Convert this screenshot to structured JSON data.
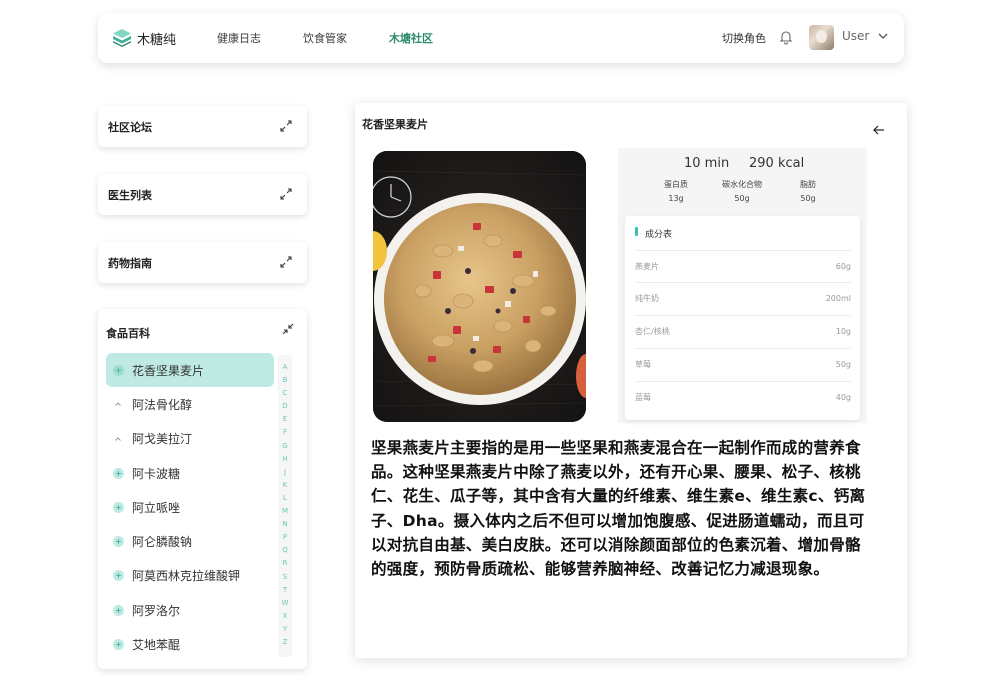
{
  "brand": {
    "name": "木糖纯",
    "icon": "cube-logo-icon"
  },
  "nav": {
    "items": [
      {
        "label": "健康日志",
        "active": false
      },
      {
        "label": "饮食管家",
        "active": false
      },
      {
        "label": "木塘社区",
        "active": true
      }
    ],
    "role_switch": "切换角色",
    "bell_icon": "bell-icon",
    "user_name": "User"
  },
  "sidebar": {
    "cards": [
      {
        "title": "社区论坛"
      },
      {
        "title": "医生列表"
      },
      {
        "title": "药物指南"
      }
    ],
    "food": {
      "title": "食品百科",
      "items": [
        {
          "name": "花香坚果麦片",
          "marker": "plus",
          "active": true
        },
        {
          "name": "阿法骨化醇",
          "marker": "caret",
          "active": false
        },
        {
          "name": "阿戈美拉汀",
          "marker": "caret",
          "active": false
        },
        {
          "name": "阿卡波糖",
          "marker": "plus",
          "active": false
        },
        {
          "name": "阿立哌唑",
          "marker": "plus",
          "active": false
        },
        {
          "name": "阿仑膦酸钠",
          "marker": "plus",
          "active": false
        },
        {
          "name": "阿莫西林克拉维酸钾",
          "marker": "plus",
          "active": false
        },
        {
          "name": "阿罗洛尔",
          "marker": "plus",
          "active": false
        },
        {
          "name": "艾地苯醌",
          "marker": "plus",
          "active": false
        }
      ],
      "alphabet": [
        "A",
        "B",
        "C",
        "D",
        "E",
        "F",
        "G",
        "H",
        "J",
        "K",
        "L",
        "M",
        "N",
        "P",
        "Q",
        "R",
        "S",
        "T",
        "W",
        "X",
        "Y",
        "Z"
      ]
    }
  },
  "detail": {
    "title": "花香坚果麦片",
    "time": "10 min",
    "kcal": "290 kcal",
    "nutrients": [
      {
        "label": "蛋白质",
        "value": "13g"
      },
      {
        "label": "碳水化合物",
        "value": "50g"
      },
      {
        "label": "脂肪",
        "value": "50g"
      }
    ],
    "ingredients_title": "成分表",
    "ingredients": [
      {
        "name": "燕麦片",
        "amount": "60g"
      },
      {
        "name": "纯牛奶",
        "amount": "200ml"
      },
      {
        "name": "杏仁/核桃",
        "amount": "10g"
      },
      {
        "name": "草莓",
        "amount": "50g"
      },
      {
        "name": "蓝莓",
        "amount": "40g"
      }
    ],
    "description": "坚果燕麦片主要指的是用一些坚果和燕麦混合在一起制作而成的营养食品。这种坚果燕麦片中除了燕麦以外，还有开心果、腰果、松子、核桃仁、花生、瓜子等，其中含有大量的纤维素、维生素e、维生素c、钙离子、Dha。摄入体内之后不但可以增加饱腹感、促进肠道蠕动，而且可以对抗自由基、美白皮肤。还可以消除颜面部位的色素沉着、增加骨骼的强度，预防骨质疏松、能够营养脑神经、改善记忆力减退现象。"
  },
  "colors": {
    "accent": "#3cc0ad",
    "active_bg": "#bfeae4",
    "nav_active": "#2a8a6a"
  }
}
